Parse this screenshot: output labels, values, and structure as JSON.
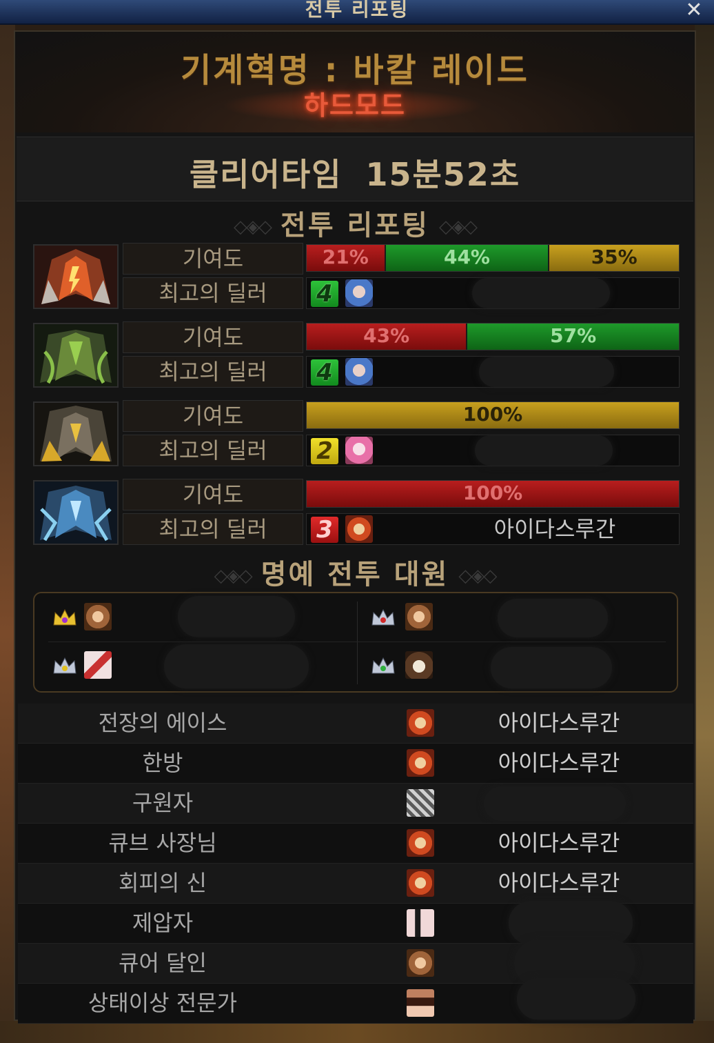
{
  "window": {
    "title": "전투 리포팅"
  },
  "header": {
    "raid_name": "기계혁명 : 바칼 레이드",
    "mode": "하드모드"
  },
  "clear": {
    "label": "클리어타임",
    "time": "15분52초"
  },
  "report": {
    "section_title": "전투 리포팅"
  },
  "labels": {
    "contribution": "기여도",
    "best_dealer": "최고의 딜러"
  },
  "bosses": [
    {
      "icon": "fire-dragon-icon",
      "segments": [
        {
          "value": "21%",
          "percent": 21,
          "color": "red"
        },
        {
          "value": "44%",
          "percent": 44,
          "color": "green"
        },
        {
          "value": "35%",
          "percent": 35,
          "color": "gold"
        }
      ],
      "dealer_badge": "4",
      "dealer_badge_color": "green",
      "dealer_name": ""
    },
    {
      "icon": "green-dragon-icon",
      "segments": [
        {
          "value": "43%",
          "percent": 43,
          "color": "red"
        },
        {
          "value": "57%",
          "percent": 57,
          "color": "green"
        }
      ],
      "dealer_badge": "4",
      "dealer_badge_color": "green",
      "dealer_name": ""
    },
    {
      "icon": "gold-dragon-icon",
      "segments": [
        {
          "value": "100%",
          "percent": 100,
          "color": "gold"
        }
      ],
      "dealer_badge": "2",
      "dealer_badge_color": "yellow",
      "dealer_name": ""
    },
    {
      "icon": "ice-dragon-icon",
      "segments": [
        {
          "value": "100%",
          "percent": 100,
          "color": "red"
        }
      ],
      "dealer_badge": "3",
      "dealer_badge_color": "red",
      "dealer_name": "아이다스루간"
    }
  ],
  "honor": {
    "section_title": "명예 전투 대원"
  },
  "awards": [
    {
      "title": "전장의 에이스",
      "name": "아이다스루간"
    },
    {
      "title": "한방",
      "name": "아이다스루간"
    },
    {
      "title": "구원자",
      "name": ""
    },
    {
      "title": "큐브 사장님",
      "name": "아이다스루간"
    },
    {
      "title": "회피의 신",
      "name": "아이다스루간"
    },
    {
      "title": "제압자",
      "name": ""
    },
    {
      "title": "큐어 달인",
      "name": ""
    },
    {
      "title": "상태이상 전문가",
      "name": ""
    }
  ],
  "colors": {
    "red": "#b81e1e",
    "green": "#1e9a2a",
    "gold": "#c8a01e",
    "title_gold": "#b68a3c",
    "mode_red": "#e85a3a"
  }
}
